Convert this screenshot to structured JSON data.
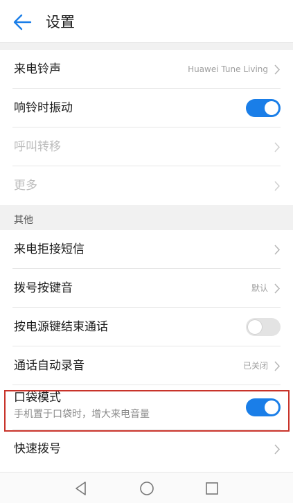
{
  "header": {
    "title": "设置"
  },
  "rows_top": [
    {
      "label": "来电铃声",
      "value": "Huawei Tune Living"
    },
    {
      "label": "响铃时振动",
      "toggle": "on"
    },
    {
      "label": "呼叫转移",
      "disabled": true
    },
    {
      "label": "更多",
      "disabled": true
    }
  ],
  "section_other": {
    "title": "其他"
  },
  "rows_other": [
    {
      "label": "来电拒接短信"
    },
    {
      "label": "拨号按键音",
      "value": "默认"
    },
    {
      "label": "按电源键结束通话",
      "toggle": "off"
    },
    {
      "label": "通话自动录音",
      "value": "已关闭"
    },
    {
      "label": "口袋模式",
      "subtitle": "手机置于口袋时，增大来电音量",
      "toggle": "on"
    },
    {
      "label": "快速拨号"
    }
  ],
  "colors": {
    "accent": "#1a7ee8",
    "highlight": "#c8332a"
  }
}
